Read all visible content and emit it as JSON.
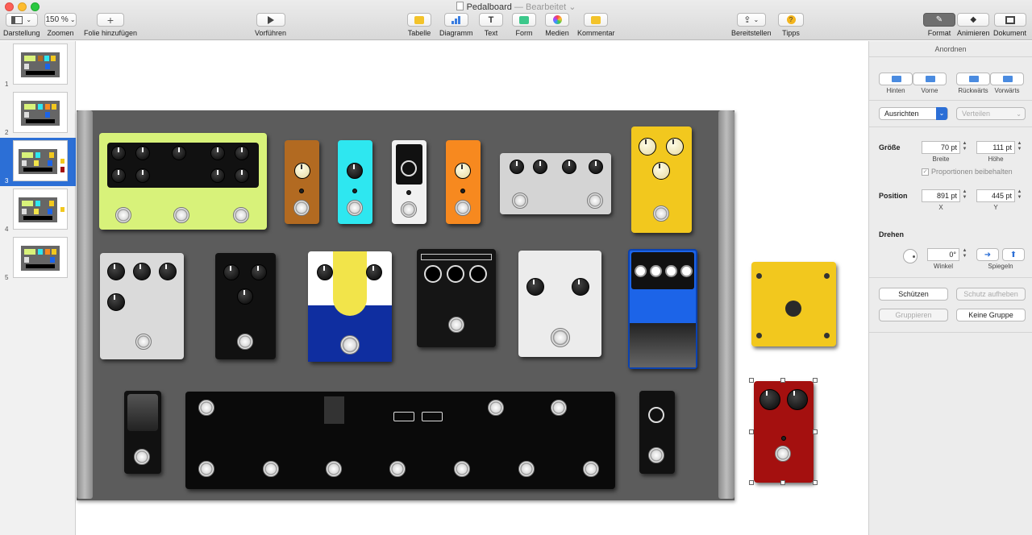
{
  "window": {
    "title": "Pedalboard",
    "status": "Bearbeitet"
  },
  "toolbar": {
    "darstellung": "Darstellung",
    "zoom_value": "150 %",
    "zoom_label": "Zoomen",
    "add_slide": "Folie hinzufügen",
    "play": "Vorführen",
    "tabelle": "Tabelle",
    "diagramm": "Diagramm",
    "text": "Text",
    "form": "Form",
    "medien": "Medien",
    "kommentar": "Kommentar",
    "share": "Bereitstellen",
    "tips": "Tipps",
    "tab_format": "Format",
    "tab_animate": "Animieren",
    "tab_document": "Dokument",
    "text_icon": "T",
    "tips_icon": "?"
  },
  "slides": [
    {
      "num": "1"
    },
    {
      "num": "2"
    },
    {
      "num": "3"
    },
    {
      "num": "4"
    },
    {
      "num": "5"
    }
  ],
  "selected_slide": "3",
  "inspector": {
    "header": "Anordnen",
    "hinten": "Hinten",
    "vorne": "Vorne",
    "rueckwaerts": "Rückwärts",
    "vorwaerts": "Vorwärts",
    "ausrichten": "Ausrichten",
    "verteilen": "Verteilen",
    "groesse": "Größe",
    "breite_val": "70 pt",
    "hoehe_val": "111 pt",
    "breite": "Breite",
    "hoehe": "Höhe",
    "proportionen": "Proportionen beibehalten",
    "position": "Position",
    "x_val": "891 pt",
    "y_val": "445 pt",
    "x": "X",
    "y": "Y",
    "drehen": "Drehen",
    "winkel_val": "0°",
    "winkel": "Winkel",
    "spiegeln": "Spiegeln",
    "schuetzen": "Schützen",
    "schutz_aufheben": "Schutz aufheben",
    "gruppieren": "Gruppieren",
    "keine_gruppe": "Keine Gruppe"
  },
  "colors": {
    "accent": "#2c6fd6",
    "board": "#5c5c5c",
    "pedal_red": "#a4100f",
    "pedal_yellow": "#f2c81e",
    "pedal_green": "#d8f27a",
    "pedal_cyan": "#2ee7f0",
    "pedal_orange": "#f7891f",
    "pedal_brown": "#b26a21",
    "pedal_blue": "#1c64e8"
  }
}
